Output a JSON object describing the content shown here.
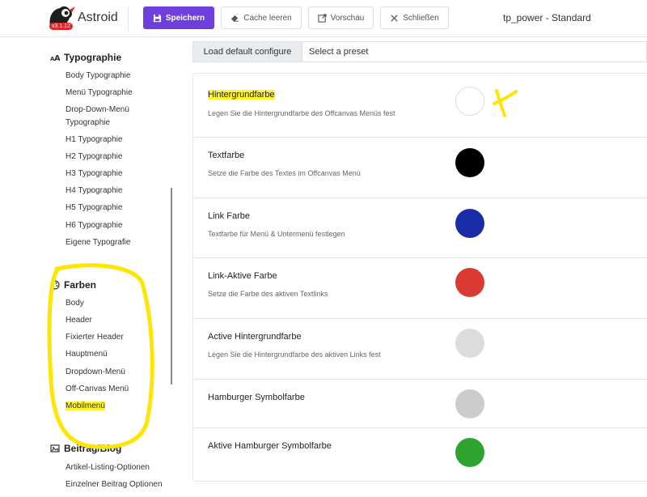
{
  "header": {
    "brand": "Astroid",
    "version": "v3.1.12",
    "save_label": "Speichern",
    "cache_label": "Cache leeren",
    "preview_label": "Vorschau",
    "close_label": "Schließen",
    "template_title": "tp_power - Standard",
    "accent_color": "#6f3fde"
  },
  "sidebar": {
    "typography": {
      "title": "Typographie",
      "items": [
        "Body Typographie",
        "Menü Typographie",
        "Drop-Down-Menü Typographie",
        "H1 Typographie",
        "H2 Typographie",
        "H3 Typographie",
        "H4 Typographie",
        "H5 Typographie",
        "H6 Typographie",
        "Eigene Typografie"
      ]
    },
    "colors": {
      "title": "Farben",
      "items": [
        "Body",
        "Header",
        "Fixierter Header",
        "Hauptmenü",
        "Dropdown-Menü",
        "Off-Canvas Menü",
        "Mobilmenü"
      ],
      "highlighted_item": "Mobilmenü"
    },
    "blog": {
      "title": "Beitrag/Blog",
      "items": [
        "Artikel-Listing-Optionen",
        "Einzelner Beitrag Optionen"
      ]
    }
  },
  "presets": {
    "load_label": "Load default configure",
    "select_label": "Select a preset"
  },
  "settings": [
    {
      "label": "Hintergrundfarbe",
      "desc": "Legen Sie die Hintergrundfarbe des Offcanvas Menüs fest",
      "color": "#ffffff"
    },
    {
      "label": "Textfarbe",
      "desc": "Setze die Farbe des Textes im Offcanvas Menü",
      "color": "#000000"
    },
    {
      "label": "Link Farbe",
      "desc": "Textfarbe für Menü & Untermenü festlegen",
      "color": "#1a2ca6"
    },
    {
      "label": "Link-Aktive Farbe",
      "desc": "Setze die Farbe des aktiven Textlinks",
      "color": "#d93a32"
    },
    {
      "label": "Active Hintergrundfarbe",
      "desc": "Legen Sie die Hintergrundfarbe des aktiven Links fest",
      "color": "#dcdcdc"
    },
    {
      "label": "Hamburger Symbolfarbe",
      "desc": "",
      "color": "#cccccc"
    },
    {
      "label": "Aktive Hamburger Symbolfarbe",
      "desc": "",
      "color": "#2ea32e"
    }
  ],
  "annotation_color": "#ffe600"
}
